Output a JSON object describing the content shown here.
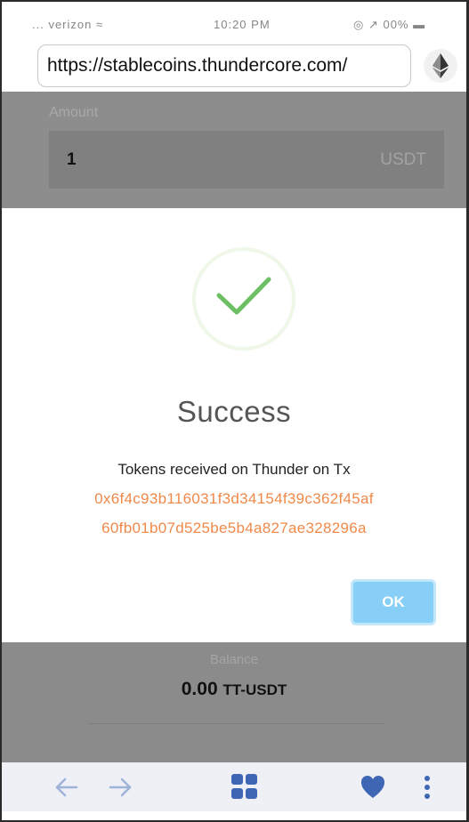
{
  "status_bar": {
    "carrier": "... verizon ≈",
    "time": "10:20 PM",
    "battery": "◎ ↗ 00% ▬"
  },
  "browser": {
    "url": "https://stablecoins.thundercore.com/",
    "network_icon": "ethereum-icon"
  },
  "form": {
    "amount_label": "Amount",
    "amount_value": "1",
    "amount_unit": "USDT"
  },
  "modal": {
    "icon": "checkmark-icon",
    "title": "Success",
    "message": "Tokens received on Thunder on Tx",
    "tx_hash_line1": "0x6f4c93b116031f3d34154f39c362f45af",
    "tx_hash_line2": "60fb01b07d525be5b4a827ae328296a",
    "ok_label": "OK"
  },
  "balance": {
    "label": "Balance",
    "value": "0.00",
    "unit": "TT-USDT"
  },
  "bottom_nav": {
    "items": [
      "back-arrow-icon",
      "forward-arrow-icon",
      "apps-grid-icon",
      "heart-icon",
      "more-vertical-icon"
    ]
  },
  "colors": {
    "accent": "#3e66b5",
    "success": "#6cc063",
    "link": "#f0894a",
    "ok_button": "#87cff6"
  }
}
